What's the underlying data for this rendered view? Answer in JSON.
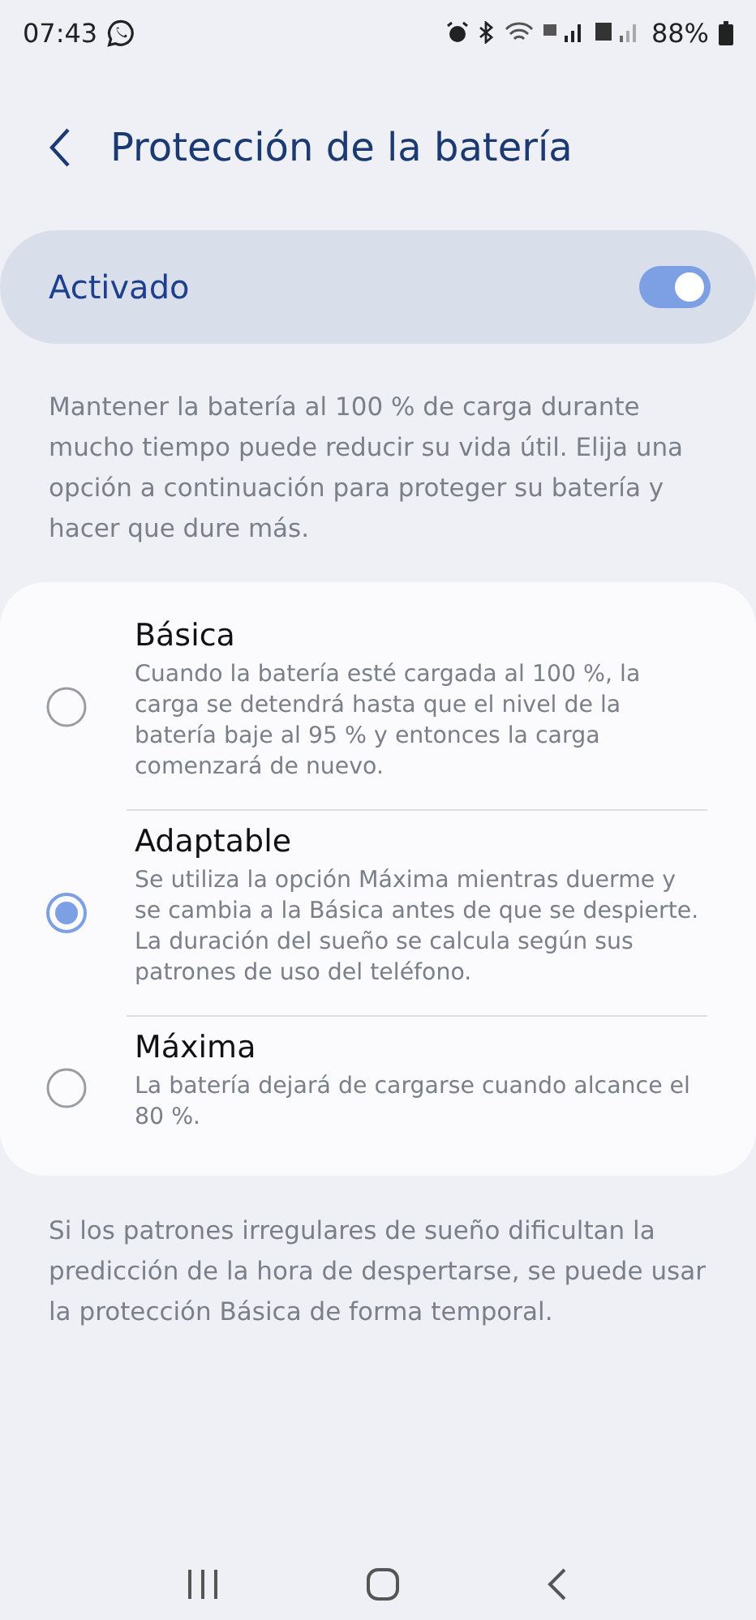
{
  "status_bar": {
    "time": "07:43",
    "battery": "88%"
  },
  "header": {
    "title": "Protección de la batería"
  },
  "master_switch": {
    "label": "Activado",
    "on": true
  },
  "description": "Mantener la batería al 100 % de carga durante mucho tiempo puede reducir su vida útil. Elija una opción a continuación para proteger su batería y hacer que dure más.",
  "options": [
    {
      "title": "Básica",
      "description": "Cuando la batería esté cargada al 100 %, la carga se detendrá hasta que el nivel de la batería baje al 95 % y entonces la carga comenzará de nuevo.",
      "selected": false
    },
    {
      "title": "Adaptable",
      "description": "Se utiliza la opción Máxima mientras duerme y se cambia a la Básica antes de que se despierte. La duración del sueño se calcula según sus patrones de uso del teléfono.",
      "selected": true
    },
    {
      "title": "Máxima",
      "description": "La batería dejará de cargarse cuando alcance el 80 %.",
      "selected": false
    }
  ],
  "footer_note": "Si los patrones irregulares de sueño dificultan la predicción de la hora de despertarse, se puede usar la protección Básica de forma temporal."
}
